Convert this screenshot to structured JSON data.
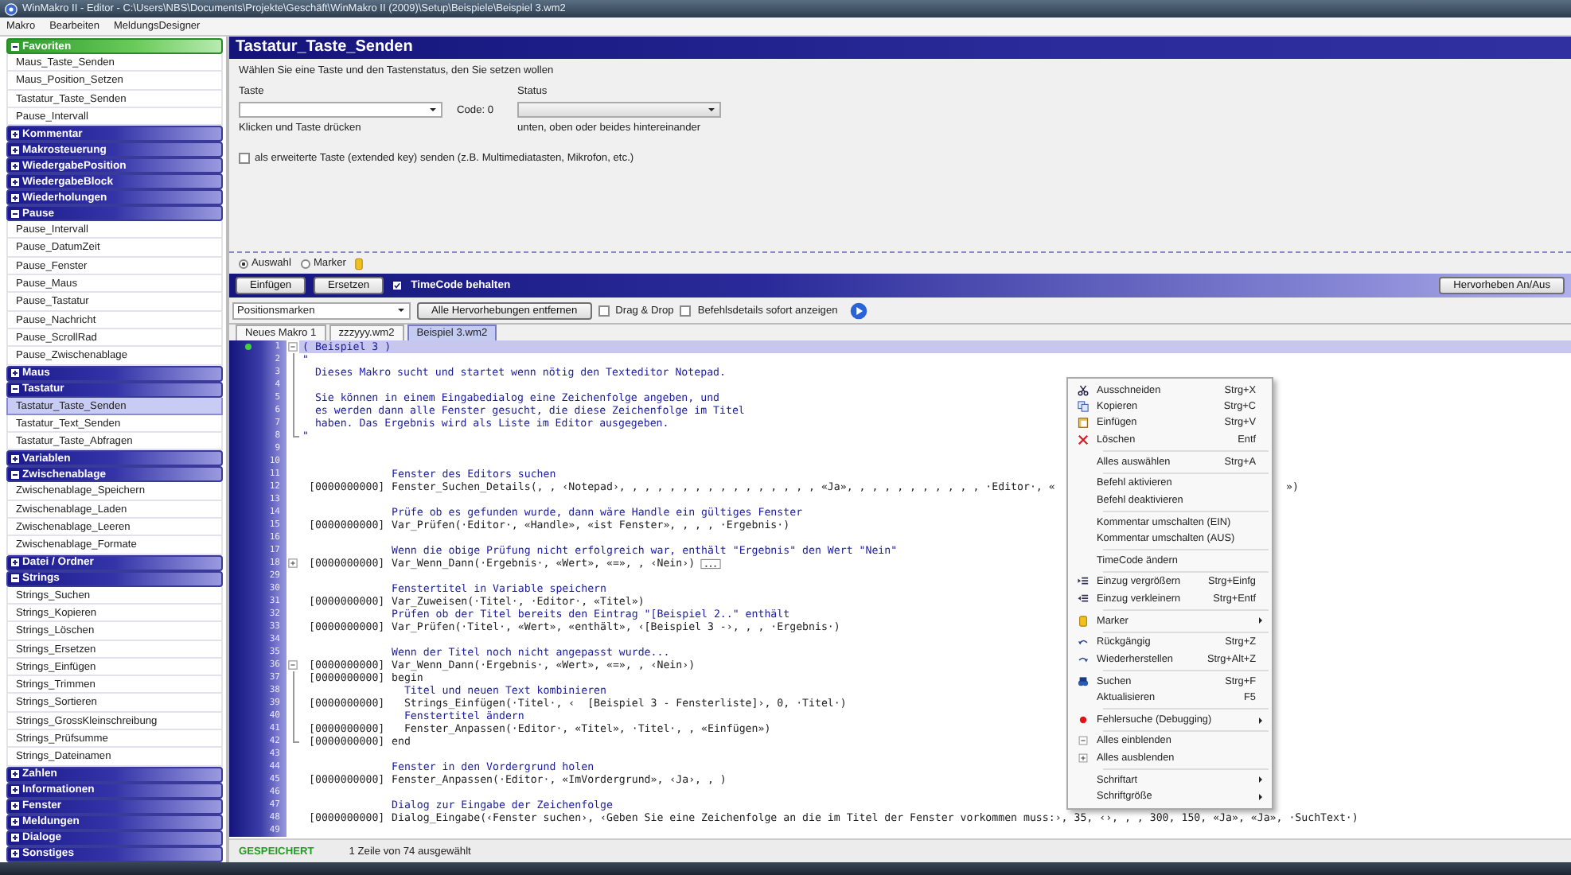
{
  "window": {
    "title": "WinMakro II - Editor - C:\\Users\\NBS\\Documents\\Projekte\\Geschäft\\WinMakro II (2009)\\Setup\\Beispiele\\Beispiel 3.wm2"
  },
  "menu_bar": [
    "Makro",
    "Bearbeiten",
    "MeldungsDesigner"
  ],
  "sidebar": {
    "groups": [
      {
        "label": "Favoriten",
        "kind": "favorites",
        "expanded": true,
        "items": [
          {
            "label": "Maus_Taste_Senden",
            "selected": false
          },
          {
            "label": "Maus_Position_Setzen",
            "selected": false
          },
          {
            "label": "Tastatur_Taste_Senden",
            "selected": false
          },
          {
            "label": "Pause_Intervall",
            "selected": false
          }
        ]
      },
      {
        "label": "Kommentar",
        "kind": "category",
        "expanded": false
      },
      {
        "label": "Makrosteuerung",
        "kind": "category",
        "expanded": false
      },
      {
        "label": "WiedergabePosition",
        "kind": "category",
        "expanded": false
      },
      {
        "label": "WiedergabeBlock",
        "kind": "category",
        "expanded": false
      },
      {
        "label": "Wiederholungen",
        "kind": "category",
        "expanded": false
      },
      {
        "label": "Pause",
        "kind": "category",
        "expanded": true,
        "items": [
          {
            "label": "Pause_Intervall",
            "selected": false
          },
          {
            "label": "Pause_DatumZeit",
            "selected": false
          },
          {
            "label": "Pause_Fenster",
            "selected": false
          },
          {
            "label": "Pause_Maus",
            "selected": false
          },
          {
            "label": "Pause_Tastatur",
            "selected": false
          },
          {
            "label": "Pause_Nachricht",
            "selected": false
          },
          {
            "label": "Pause_ScrollRad",
            "selected": false
          },
          {
            "label": "Pause_Zwischenablage",
            "selected": false
          }
        ]
      },
      {
        "label": "Maus",
        "kind": "category",
        "expanded": false
      },
      {
        "label": "Tastatur",
        "kind": "category",
        "expanded": true,
        "items": [
          {
            "label": "Tastatur_Taste_Senden",
            "selected": true
          },
          {
            "label": "Tastatur_Text_Senden",
            "selected": false
          },
          {
            "label": "Tastatur_Taste_Abfragen",
            "selected": false
          }
        ]
      },
      {
        "label": "Variablen",
        "kind": "category",
        "expanded": false
      },
      {
        "label": "Zwischenablage",
        "kind": "category",
        "expanded": true,
        "items": [
          {
            "label": "Zwischenablage_Speichern",
            "selected": false
          },
          {
            "label": "Zwischenablage_Laden",
            "selected": false
          },
          {
            "label": "Zwischenablage_Leeren",
            "selected": false
          },
          {
            "label": "Zwischenablage_Formate",
            "selected": false
          }
        ]
      },
      {
        "label": "Datei / Ordner",
        "kind": "category",
        "expanded": false
      },
      {
        "label": "Strings",
        "kind": "category",
        "expanded": true,
        "items": [
          {
            "label": "Strings_Suchen",
            "selected": false
          },
          {
            "label": "Strings_Kopieren",
            "selected": false
          },
          {
            "label": "Strings_Löschen",
            "selected": false
          },
          {
            "label": "Strings_Ersetzen",
            "selected": false
          },
          {
            "label": "Strings_Einfügen",
            "selected": false
          },
          {
            "label": "Strings_Trimmen",
            "selected": false
          },
          {
            "label": "Strings_Sortieren",
            "selected": false
          },
          {
            "label": "Strings_GrossKleinschreibung",
            "selected": false
          },
          {
            "label": "Strings_Prüfsumme",
            "selected": false
          },
          {
            "label": "Strings_Dateinamen",
            "selected": false
          }
        ]
      },
      {
        "label": "Zahlen",
        "kind": "category",
        "expanded": false
      },
      {
        "label": "Informationen",
        "kind": "category",
        "expanded": false
      },
      {
        "label": "Fenster",
        "kind": "category",
        "expanded": false
      },
      {
        "label": "Meldungen",
        "kind": "category",
        "expanded": false
      },
      {
        "label": "Dialoge",
        "kind": "category",
        "expanded": false
      },
      {
        "label": "Sonstiges",
        "kind": "category",
        "expanded": false
      }
    ]
  },
  "command_panel": {
    "title": "Tastatur_Taste_Senden",
    "instruction": "Wählen Sie eine Taste und den Tastenstatus, den Sie setzen wollen",
    "key_label": "Taste",
    "code": "Code: 0",
    "status_label": "Status",
    "key_hint": "Klicken und Taste drücken",
    "status_hint": "unten, oben oder beides hintereinander",
    "extended_key": {
      "label": "als erweiterte Taste (extended key) senden (z.B. Multimediatasten, Mikrofon, etc.)",
      "checked": false
    }
  },
  "insert_target": [
    {
      "label": "Auswahl",
      "selected": true
    },
    {
      "label": "Marker",
      "selected": false
    }
  ],
  "action_bar": {
    "buttons": [
      "Einfügen",
      "Ersetzen"
    ],
    "timecode": {
      "label": "TimeCode behalten",
      "checked": true
    },
    "highlight_button": "Hervorheben An/Aus"
  },
  "editor_toolbar": {
    "marker_dropdown": "Positionsmarken",
    "clear_button": "Alle Hervorhebungen entfernen",
    "options": [
      {
        "label": "Drag & Drop",
        "checked": false
      },
      {
        "label": "Befehlsdetails sofort anzeigen",
        "checked": false
      }
    ]
  },
  "tabs": [
    {
      "label": "Neues Makro 1",
      "selected": false
    },
    {
      "label": "zzzyyy.wm2",
      "selected": false
    },
    {
      "label": "Beispiel 3.wm2",
      "selected": true
    }
  ],
  "editor": {
    "lines": [
      {
        "number": "1",
        "kind": "doc",
        "text": "( Beispiel 3 )",
        "fold_start": true,
        "collapsed": false,
        "selected": true,
        "bookmark": true
      },
      {
        "number": "2",
        "kind": "doc",
        "text": "\"",
        "in_fold": true,
        "selected": false,
        "bookmark": false
      },
      {
        "number": "3",
        "kind": "doc",
        "text": "  Dieses Makro sucht und startet wenn nötig den Texteditor Notepad.",
        "in_fold": true,
        "selected": false,
        "bookmark": false
      },
      {
        "number": "4",
        "kind": "blank",
        "in_fold": true,
        "selected": false,
        "bookmark": false
      },
      {
        "number": "5",
        "kind": "doc",
        "text": "  Sie können in einem Eingabedialog eine Zeichenfolge angeben, und",
        "in_fold": true,
        "selected": false,
        "bookmark": false
      },
      {
        "number": "6",
        "kind": "doc",
        "text": "  es werden dann alle Fenster gesucht, die diese Zeichenfolge im Titel",
        "in_fold": true,
        "selected": false,
        "bookmark": false
      },
      {
        "number": "7",
        "kind": "doc",
        "text": "  haben. Das Ergebnis wird als Liste im Editor ausgegeben.",
        "in_fold": true,
        "selected": false,
        "bookmark": false
      },
      {
        "number": "8",
        "kind": "doc",
        "text": "\"",
        "fold_end": true,
        "selected": false,
        "bookmark": false
      },
      {
        "number": "9",
        "kind": "blank",
        "selected": false,
        "bookmark": false
      },
      {
        "number": "10",
        "kind": "blank",
        "selected": false,
        "bookmark": false
      },
      {
        "number": "11",
        "kind": "comment",
        "text": "Fenster des Editors suchen",
        "selected": false,
        "bookmark": false
      },
      {
        "number": "12",
        "kind": "code",
        "stamp": "[0000000000]",
        "text": "Fenster_Suchen_Details(, , ‹Notepad›, , , , , , , , , , , , , , , , «Ja», , , , , , , , , , , ·Editor·, «",
        "tail": "»)",
        "selected": false,
        "bookmark": false
      },
      {
        "number": "13",
        "kind": "blank",
        "selected": false,
        "bookmark": false
      },
      {
        "number": "14",
        "kind": "comment",
        "text": "Prüfe ob es gefunden wurde, dann wäre Handle ein gültiges Fenster",
        "selected": false,
        "bookmark": false
      },
      {
        "number": "15",
        "kind": "code",
        "stamp": "[0000000000]",
        "text": "Var_Prüfen(·Editor·, «Handle», «ist Fenster», , , , ·Ergebnis·)",
        "selected": false,
        "bookmark": false
      },
      {
        "number": "16",
        "kind": "blank",
        "selected": false,
        "bookmark": false
      },
      {
        "number": "17",
        "kind": "comment",
        "text": "Wenn die obige Prüfung nicht erfolgreich war, enthält \"Ergebnis\" den Wert \"Nein\"",
        "selected": false,
        "bookmark": false
      },
      {
        "number": "18",
        "kind": "code",
        "stamp": "[0000000000]",
        "text": "Var_Wenn_Dann(·Ergebnis·, «Wert», «=», , ‹Nein›)",
        "fold_start": true,
        "collapsed": true,
        "selected": false,
        "bookmark": false
      },
      {
        "number": "29",
        "kind": "blank",
        "selected": false,
        "bookmark": false
      },
      {
        "number": "30",
        "kind": "comment",
        "text": "Fenstertitel in Variable speichern",
        "selected": false,
        "bookmark": false
      },
      {
        "number": "31",
        "kind": "code",
        "stamp": "[0000000000]",
        "text": "Var_Zuweisen(·Titel·, ·Editor·, «Titel»)",
        "selected": false,
        "bookmark": false
      },
      {
        "number": "32",
        "kind": "comment",
        "text": "Prüfen ob der Titel bereits den Eintrag \"[Beispiel 2..\" enthält",
        "selected": false,
        "bookmark": false
      },
      {
        "number": "33",
        "kind": "code",
        "stamp": "[0000000000]",
        "text": "Var_Prüfen(·Titel·, «Wert», «enthält», ‹[Beispiel 3 -›, , , ·Ergebnis·)",
        "selected": false,
        "bookmark": false
      },
      {
        "number": "34",
        "kind": "blank",
        "selected": false,
        "bookmark": false
      },
      {
        "number": "35",
        "kind": "comment",
        "text": "Wenn der Titel noch nicht angepasst wurde...",
        "selected": false,
        "bookmark": false
      },
      {
        "number": "36",
        "kind": "code",
        "stamp": "[0000000000]",
        "text": "Var_Wenn_Dann(·Ergebnis·, «Wert», «=», , ‹Nein›)",
        "fold_start": true,
        "collapsed": false,
        "selected": false,
        "bookmark": false
      },
      {
        "number": "37",
        "kind": "code",
        "stamp": "[0000000000]",
        "text": "begin",
        "in_fold": true,
        "selected": false,
        "bookmark": false
      },
      {
        "number": "38",
        "kind": "comment",
        "text": "  Titel und neuen Text kombinieren",
        "in_fold": true,
        "selected": false,
        "bookmark": false
      },
      {
        "number": "39",
        "kind": "code",
        "stamp": "[0000000000]",
        "text": "  Strings_Einfügen(·Titel·, ‹  [Beispiel 3 - Fensterliste]›, 0, ·Titel·)",
        "in_fold": true,
        "selected": false,
        "bookmark": false
      },
      {
        "number": "40",
        "kind": "comment",
        "text": "  Fenstertitel ändern",
        "in_fold": true,
        "selected": false,
        "bookmark": false
      },
      {
        "number": "41",
        "kind": "code",
        "stamp": "[0000000000]",
        "text": "  Fenster_Anpassen(·Editor·, «Titel», ·Titel·, , «Einfügen»)",
        "in_fold": true,
        "selected": false,
        "bookmark": false
      },
      {
        "number": "42",
        "kind": "code",
        "stamp": "[0000000000]",
        "text": "end",
        "fold_end": true,
        "selected": false,
        "bookmark": false
      },
      {
        "number": "43",
        "kind": "blank",
        "selected": false,
        "bookmark": false
      },
      {
        "number": "44",
        "kind": "comment",
        "text": "Fenster in den Vordergrund holen",
        "selected": false,
        "bookmark": false
      },
      {
        "number": "45",
        "kind": "code",
        "stamp": "[0000000000]",
        "text": "Fenster_Anpassen(·Editor·, «ImVordergrund», ‹Ja›, , )",
        "selected": false,
        "bookmark": false
      },
      {
        "number": "46",
        "kind": "blank",
        "selected": false,
        "bookmark": false
      },
      {
        "number": "47",
        "kind": "comment",
        "text": "Dialog zur Eingabe der Zeichenfolge",
        "selected": false,
        "bookmark": false
      },
      {
        "number": "48",
        "kind": "code",
        "stamp": "[0000000000]",
        "text": "Dialog_Eingabe(‹Fenster suchen›, ‹Geben Sie eine Zeichenfolge an die im Titel der Fenster vorkommen muss:›, 35, ‹›, , , 300, 150, «Ja», «Ja», ·SuchText·)",
        "selected": false,
        "bookmark": false
      },
      {
        "number": "49",
        "kind": "blank",
        "selected": false,
        "bookmark": false
      }
    ]
  },
  "context_menu": {
    "items": [
      {
        "kind": "item",
        "label": "Ausschneiden",
        "shortcut": "Strg+X"
      },
      {
        "kind": "item",
        "label": "Kopieren",
        "shortcut": "Strg+C"
      },
      {
        "kind": "item",
        "label": "Einfügen",
        "shortcut": "Strg+V"
      },
      {
        "kind": "item",
        "label": "Löschen",
        "shortcut": "Entf"
      },
      {
        "kind": "separator"
      },
      {
        "kind": "item",
        "label": "Alles auswählen",
        "shortcut": "Strg+A"
      },
      {
        "kind": "separator"
      },
      {
        "kind": "item",
        "label": "Befehl aktivieren"
      },
      {
        "kind": "item",
        "label": "Befehl deaktivieren"
      },
      {
        "kind": "separator"
      },
      {
        "kind": "item",
        "label": "Kommentar umschalten (EIN)"
      },
      {
        "kind": "item",
        "label": "Kommentar umschalten (AUS)"
      },
      {
        "kind": "separator"
      },
      {
        "kind": "item",
        "label": "TimeCode ändern"
      },
      {
        "kind": "separator"
      },
      {
        "kind": "item",
        "label": "Einzug vergrößern",
        "shortcut": "Strg+Einfg"
      },
      {
        "kind": "item",
        "label": "Einzug verkleinern",
        "shortcut": "Strg+Entf"
      },
      {
        "kind": "separator"
      },
      {
        "kind": "submenu",
        "label": "Marker"
      },
      {
        "kind": "separator"
      },
      {
        "kind": "item",
        "label": "Rückgängig",
        "shortcut": "Strg+Z"
      },
      {
        "kind": "item",
        "label": "Wiederherstellen",
        "shortcut": "Strg+Alt+Z"
      },
      {
        "kind": "separator"
      },
      {
        "kind": "item",
        "label": "Suchen",
        "shortcut": "Strg+F"
      },
      {
        "kind": "item",
        "label": "Aktualisieren",
        "shortcut": "F5"
      },
      {
        "kind": "separator"
      },
      {
        "kind": "submenu",
        "label": "Fehlersuche (Debugging)"
      },
      {
        "kind": "separator"
      },
      {
        "kind": "item",
        "label": "Alles einblenden"
      },
      {
        "kind": "item",
        "label": "Alles ausblenden"
      },
      {
        "kind": "separator"
      },
      {
        "kind": "submenu",
        "label": "Schriftart"
      },
      {
        "kind": "submenu",
        "label": "Schriftgröße"
      }
    ]
  },
  "status_bar": {
    "state": "GESPEICHERT",
    "selection": "1 Zeile von 74 ausgewählt"
  }
}
